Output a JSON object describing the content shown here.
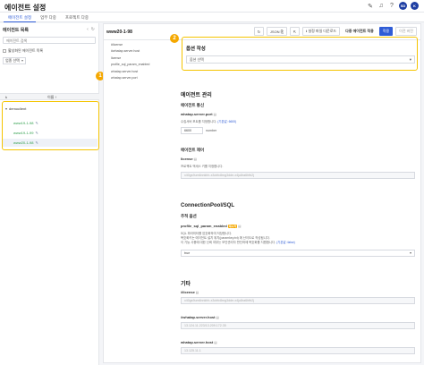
{
  "header": {
    "title": "에이전트 설정",
    "avatar_initials": "SD",
    "avatar_letter": "K"
  },
  "tabs": [
    {
      "label": "에이전트 설정"
    },
    {
      "label": "업무 다중"
    },
    {
      "label": "프로젝트 다중"
    }
  ],
  "sidebar": {
    "title": "에이전트 목록",
    "search_placeholder": "에이전트 검색",
    "checkbox_label": "활성화된 에이전트 목록",
    "select_value": "업종 선택",
    "table": {
      "col_k": "k",
      "col_name": "이름 ↑"
    },
    "tree": {
      "group": "democlient",
      "items": [
        "www19-1-98",
        "www19-1-99",
        "www20-1-98"
      ]
    },
    "badge": "1"
  },
  "main": {
    "agent_name": "www20-1-98",
    "buttons": {
      "json": "JSON",
      "download": "설정 파일 다운로드",
      "multi_apply": "다중 에이전트 적용",
      "apply": "적용",
      "prev": "이전 버전"
    },
    "key_list": [
      "#license",
      "#whatap.server.host",
      "license",
      "profile_sql_param_enabled",
      "whatap.server.host",
      "whatap.server.port"
    ],
    "option": {
      "title": "옵션 작성",
      "select_placeholder": "옵션 선택",
      "badge": "2"
    },
    "agent_mgmt": {
      "title": "에이전트 관리",
      "comm": {
        "title": "에이전트 통신",
        "port_label": "whatap.server.port",
        "port_desc": "수집서버 포트를 지정합니다.",
        "port_desc_link": "(기본값: 6600)",
        "port_value": "6600",
        "port_unit": "number"
      },
      "control": {
        "title": "에이전트 제어",
        "license_label": "license",
        "license_desc": "프로젝트 액세스 키를 지정합니다.",
        "license_value": "x40gs9um6nnkhh-x3cbfc8rng3dde-x4ju8ra6hfb2j"
      }
    },
    "connection_pool": {
      "title": "ConnectionPool/SQL",
      "trace": {
        "title": "추적 옵션",
        "label": "profile_sql_param_enabled",
        "tag": "재시작",
        "desc1": "SQL 파라미터를 암호화하여 저장합니다.",
        "desc2": "복호화키는 에이전트 설치 위치(paramkey.txt) 에 난이도로 작성됩니다.",
        "desc3": "이 기능 사용에 대한 신뢰 여부는 보안관리자 판단하에 복호화를 지원합니다.",
        "desc_link": "(기본값: false)",
        "select_value": "true"
      }
    },
    "etc": {
      "title": "기타",
      "license_hash_label": "#license",
      "license_hash_value": "x40gs9um6nnkhh-x3cbfc8rng3dde-x4ju8ra6hfb2j",
      "host_hash_label": "#whatap.server.host",
      "host_hash_value": "13.124.11.223/13.209.172.35",
      "host_label": "whatap.server.host",
      "host_value": "13.125.11.1"
    }
  }
}
